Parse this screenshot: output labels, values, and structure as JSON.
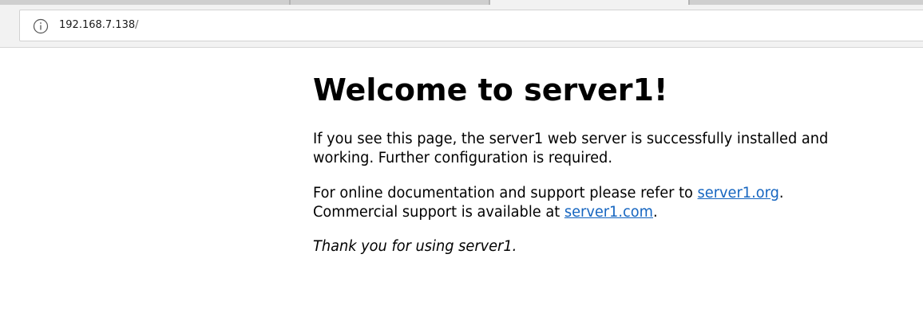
{
  "browser": {
    "url_host": "192.168.7.138",
    "url_path": "/"
  },
  "page": {
    "heading": "Welcome to server1!",
    "para1_line1": "If you see this page, the server1 web server is successfully installed and",
    "para1_line2": "working. Further configuration is required.",
    "para2_line1_text": "For online documentation and support please refer to ",
    "para2_link1": "server1.org",
    "para2_line1_end": ".",
    "para2_line2_text": "Commercial support is available at ",
    "para2_link2": "server1.com",
    "para2_line2_end": ".",
    "para3": "Thank you for using server1.",
    "link_color": "#1565c0"
  }
}
